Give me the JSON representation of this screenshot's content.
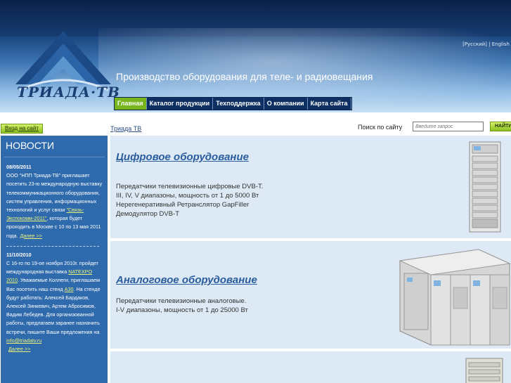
{
  "header": {
    "logo_text": "ТРИАДА·ТВ",
    "languages": "[Русский] | English",
    "tagline": "Производство оборудования для теле- и радиовещания",
    "colors": {
      "accent": "#78b51d",
      "brand": "#1b3f73"
    }
  },
  "nav": {
    "items": [
      {
        "label": "Главная",
        "active": true
      },
      {
        "label": "Каталог продукции",
        "active": false
      },
      {
        "label": "Техподдержка",
        "active": false
      },
      {
        "label": "О компании",
        "active": false
      },
      {
        "label": "Карта сайта",
        "active": false
      }
    ]
  },
  "topbar": {
    "login_label": "Вход на сайт",
    "breadcrumb": "Триада ТВ",
    "search_label": "Поиск по сайту",
    "search_placeholder": "Введите запрос",
    "search_button": "НАЙТИ"
  },
  "sidebar": {
    "title": "НОВОСТИ",
    "news": [
      {
        "date": "08/05/2011",
        "text_before": "ООО \"НПП Триада-ТВ\" приглашает посетить 23-ю международную выставку телекоммуникационного оборудования, систем управления, информационных технологий и услуг связи ",
        "link": "\"Связь-Экспокомм-2011\"",
        "text_after": ", которая будет проходить в Москве с 10 по 13 мая 2011 года.",
        "more": "Далее >>"
      },
      {
        "date": "11/10/2010",
        "text_before": "С 16-го по 19-ое ноября 2010г. пройдет международная выставка ",
        "link": "NATEXPO 2010",
        "text_mid": ". Уважаемые Коллеги, приглашаем Вас посетить наш стенд ",
        "link2": "А30",
        "text_after": ". На стенде будут работать: Алексей Бардаков, Алексей Зинкевич, Артем Абросимов, Вадим Лебедев. Для организованной работы, предлагаем заранее назначить встречи, пишите Ваши предложения на ",
        "email": "info@triadatv.ru",
        "more": "Далее >>"
      }
    ]
  },
  "panels": [
    {
      "title": "Цифровое оборудование",
      "lines": [
        "Передатчики телевизионные цифровые DVB-T.",
        "III, IV, V диапазоны, мощность от 1 до 5000 Вт",
        "Нерегенеративный Ретранслятор GapFiller",
        "Демодулятор DVB-T"
      ]
    },
    {
      "title": "Аналоговое оборудование",
      "lines": [
        "Передатчики телевизионные аналоговые.",
        "I-V диапазоны, мощность от 1 до 25000 Вт"
      ]
    }
  ]
}
